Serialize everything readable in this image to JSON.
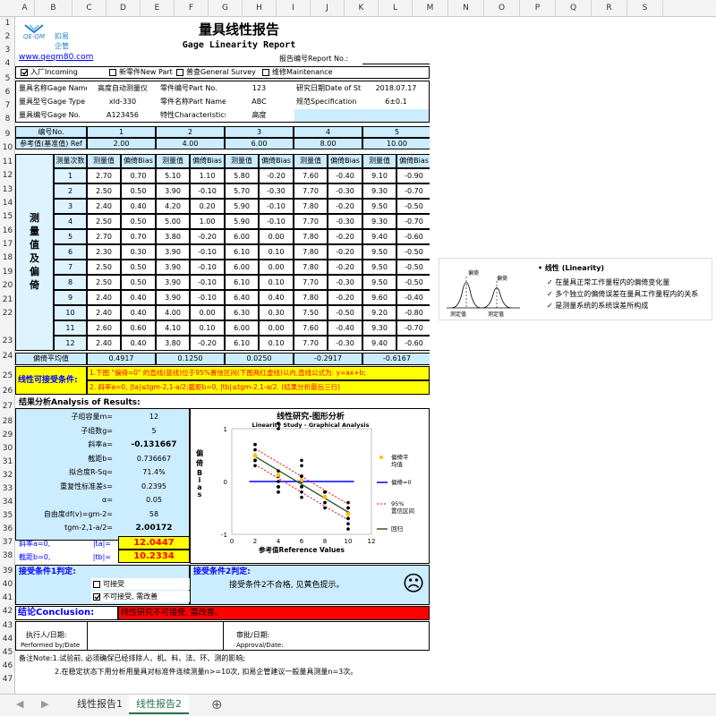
{
  "columns": [
    "A",
    "B",
    "C",
    "D",
    "E",
    "F",
    "G",
    "H",
    "I",
    "J",
    "K",
    "L",
    "M",
    "N",
    "O",
    "P",
    "Q",
    "R",
    "S"
  ],
  "rows": [
    "1",
    "2",
    "3",
    "4",
    "5",
    "6",
    "7",
    "8",
    "9",
    "10",
    "11",
    "12",
    "13",
    "14",
    "15",
    "16",
    "17",
    "18",
    "19",
    "20",
    "21",
    "22",
    "23",
    "24",
    "25",
    "26",
    "27",
    "28",
    "29",
    "30",
    "31",
    "32",
    "33",
    "34",
    "35",
    "36",
    "37",
    "38",
    "39",
    "40",
    "41",
    "42",
    "43",
    "44",
    "45",
    "46",
    "47"
  ],
  "logo": {
    "cn1": "扣易",
    "cn2": "企管",
    "en": "QE-QM",
    "url": "www.qeqm80.com"
  },
  "title": {
    "cn": "量具线性报告",
    "en": "Gage Linearity Report",
    "report_no_label": "报告编号Report No.:"
  },
  "checks": [
    {
      "label": "入厂Incoming",
      "checked": true
    },
    {
      "label": "新零件New Part",
      "checked": false
    },
    {
      "label": "普查General Survey",
      "checked": false
    },
    {
      "label": "维修Maintenance",
      "checked": false
    }
  ],
  "info": {
    "gage_name_l": "量具名称Gage Name",
    "gage_name_v": "高度自动测量仪",
    "part_no_l": "零件编号Part No.",
    "part_no_v": "123",
    "date_l": "研究日期Date of St",
    "date_v": "2018.07.17",
    "gage_type_l": "量具型号Gage Type",
    "gage_type_v": "xld-330",
    "part_name_l": "零件名称Part Name",
    "part_name_v": "ABC",
    "spec_l": "规范Specification",
    "spec_v": "6±0.1",
    "gage_no_l": "量具编号Gage No.",
    "gage_no_v": "A123456",
    "char_l": "特性Characteristics",
    "char_v": "高度"
  },
  "part_row": {
    "label": "编号No.",
    "nums": [
      "1",
      "2",
      "3",
      "4",
      "5"
    ]
  },
  "ref_row": {
    "label": "参考值(基准值) Ref",
    "values": [
      "2.00",
      "4.00",
      "6.00",
      "8.00",
      "10.00"
    ]
  },
  "meas_header": {
    "count": "测量次数",
    "meas": "测量值",
    "bias": "偏倚Bias"
  },
  "side_label": "测量值及偏倚",
  "meas_rows": [
    {
      "n": "1",
      "v": [
        "2.70",
        "0.70",
        "5.10",
        "1.10",
        "5.80",
        "-0.20",
        "7.60",
        "-0.40",
        "9.10",
        "-0.90"
      ]
    },
    {
      "n": "2",
      "v": [
        "2.50",
        "0.50",
        "3.90",
        "-0.10",
        "5.70",
        "-0.30",
        "7.70",
        "-0.30",
        "9.30",
        "-0.70"
      ]
    },
    {
      "n": "3",
      "v": [
        "2.40",
        "0.40",
        "4.20",
        "0.20",
        "5.90",
        "-0.10",
        "7.80",
        "-0.20",
        "9.50",
        "-0.50"
      ]
    },
    {
      "n": "4",
      "v": [
        "2.50",
        "0.50",
        "5.00",
        "1.00",
        "5.90",
        "-0.10",
        "7.70",
        "-0.30",
        "9.30",
        "-0.70"
      ]
    },
    {
      "n": "5",
      "v": [
        "2.70",
        "0.70",
        "3.80",
        "-0.20",
        "6.00",
        "0.00",
        "7.80",
        "-0.20",
        "9.40",
        "-0.60"
      ]
    },
    {
      "n": "6",
      "v": [
        "2.30",
        "0.30",
        "3.90",
        "-0.10",
        "6.10",
        "0.10",
        "7.80",
        "-0.20",
        "9.50",
        "-0.50"
      ]
    },
    {
      "n": "7",
      "v": [
        "2.50",
        "0.50",
        "3.90",
        "-0.10",
        "6.00",
        "0.00",
        "7.80",
        "-0.20",
        "9.50",
        "-0.50"
      ]
    },
    {
      "n": "8",
      "v": [
        "2.50",
        "0.50",
        "3.90",
        "-0.10",
        "6.10",
        "0.10",
        "7.70",
        "-0.30",
        "9.50",
        "-0.50"
      ]
    },
    {
      "n": "9",
      "v": [
        "2.40",
        "0.40",
        "3.90",
        "-0.10",
        "6.40",
        "0.40",
        "7.80",
        "-0.20",
        "9.60",
        "-0.40"
      ]
    },
    {
      "n": "10",
      "v": [
        "2.40",
        "0.40",
        "4.00",
        "0.00",
        "6.30",
        "0.30",
        "7.50",
        "-0.50",
        "9.20",
        "-0.80"
      ]
    },
    {
      "n": "11",
      "v": [
        "2.60",
        "0.60",
        "4.10",
        "0.10",
        "6.00",
        "0.00",
        "7.60",
        "-0.40",
        "9.30",
        "-0.70"
      ]
    },
    {
      "n": "12",
      "v": [
        "2.40",
        "0.40",
        "3.80",
        "-0.20",
        "6.10",
        "0.10",
        "7.70",
        "-0.30",
        "9.40",
        "-0.60"
      ]
    }
  ],
  "avg_row": {
    "label": "偏倚平均值",
    "values": [
      "0.4917",
      "0.1250",
      "0.0250",
      "-0.2917",
      "-0.6167"
    ]
  },
  "linearity": {
    "label": "线性可接受条件:",
    "line1": "1.下图 \"偏倚=0\" 的直线(蓝线)位于95%置信区间(下图两红虚线)以内,直线公式为: y=ax+b;",
    "line2": "2. 斜率a=0, |ta|≤tgm-2,1-a/2;截距b=0, |tb|≤tgm-2,1-a/2. (结果分析最后三行)"
  },
  "results": {
    "title": "结果分析Analysis of Results:",
    "rows": [
      {
        "l": "子组容量m=",
        "v": "12"
      },
      {
        "l": "子组数g=",
        "v": "5"
      },
      {
        "l": "斜率a=",
        "v": "-0.131667"
      },
      {
        "l": "截距b=",
        "v": "0.736667"
      },
      {
        "l": "拟合度R-Sq=",
        "v": "71.4%"
      },
      {
        "l": "重复性标准差s=",
        "v": "0.2395"
      },
      {
        "l": "α=",
        "v": "0.05"
      },
      {
        "l": "自由度df(v)=gm-2=",
        "v": "58"
      },
      {
        "l": "tgm-2,1-a/2=",
        "v": "2.00172"
      }
    ],
    "ta_label1": "斜率a=0,",
    "ta_label2": "|ta|=",
    "ta_value": "12.0447",
    "tb_label1": "截距b=0,",
    "tb_label2": "|tb|=",
    "tb_value": "10.2334"
  },
  "chart_data": {
    "type": "scatter",
    "title": "线性研究-图形分析",
    "subtitle": "Linearity Study - Graphical Analysis",
    "ylabel": "偏倚Bias",
    "xlabel": "参考值Reference Values",
    "xlim": [
      0,
      12
    ],
    "ylim": [
      -1,
      1
    ],
    "x_ticks": [
      "0",
      "2",
      "4",
      "6",
      "8",
      "10",
      "12"
    ],
    "y_ticks": [
      "1",
      "0",
      "-1"
    ],
    "points_x": [
      2,
      4,
      6,
      8,
      10
    ],
    "bias_points": [
      [
        0.7,
        0.5,
        0.4,
        0.5,
        0.7,
        0.3,
        0.5,
        0.5,
        0.4,
        0.4,
        0.6,
        0.4
      ],
      [
        1.1,
        -0.1,
        0.2,
        1.0,
        -0.2,
        -0.1,
        -0.1,
        -0.1,
        -0.1,
        0.0,
        0.1,
        -0.2
      ],
      [
        -0.2,
        -0.3,
        -0.1,
        -0.1,
        0.0,
        0.1,
        0.0,
        0.1,
        0.4,
        0.3,
        0.0,
        0.1
      ],
      [
        -0.4,
        -0.3,
        -0.2,
        -0.3,
        -0.2,
        -0.2,
        -0.2,
        -0.3,
        -0.2,
        -0.5,
        -0.4,
        -0.3
      ],
      [
        -0.9,
        -0.7,
        -0.5,
        -0.7,
        -0.6,
        -0.5,
        -0.5,
        -0.5,
        -0.4,
        -0.8,
        -0.7,
        -0.6
      ]
    ],
    "avg_bias": [
      0.4917,
      0.125,
      0.025,
      -0.2917,
      -0.6167
    ],
    "regression": {
      "slope": -0.131667,
      "intercept": 0.736667
    },
    "legend": [
      {
        "name": "偏倚平均值",
        "color": "#ffc000"
      },
      {
        "name": "偏倚=0",
        "color": "#0000ff"
      },
      {
        "name": "95%置信区间",
        "color": "#ff0000"
      },
      {
        "name": "回归",
        "color": "#385723"
      }
    ]
  },
  "accept1": {
    "label": "接受条件1判定:",
    "opt1": "可接受",
    "opt2": "不可接受, 需改善",
    "opt1_checked": false,
    "opt2_checked": true
  },
  "accept2": {
    "label": "接受条件2判定:",
    "text": "接受条件2不合格, 见黄色提示。",
    "face": "☹"
  },
  "conclusion": {
    "label": "结论Conclusion:",
    "text": "线性研究不可接受, 需改善。"
  },
  "sign": {
    "exec_cn": "执行人/日期:",
    "exec_en": "Performed by/Date",
    "approve_cn": "审批/日期:",
    "approve_en": "Approval/Date:"
  },
  "notes": {
    "n1": "备注Note:1.试验前, 必须确保已经排除人、机、料、法、环、测的影响;",
    "n2": "2.在稳定状态下用分析用量具对标准件连续测量n>=10次, 扣易企管建议一般量具测量n=3次。"
  },
  "side_image": {
    "bullet": "线性 (Linearity)",
    "items": [
      "在量具正常工作量程内的偏倚变化量",
      "多个独立的偏倚误差在量具工作量程内的关系",
      "是测量系统的系统误差所构成"
    ],
    "label1": "偏倚",
    "label2": "偏倚",
    "small1": "测定值",
    "small2": "测定值"
  },
  "tabs": [
    "线性报告1",
    "线性报告2"
  ],
  "colors": {
    "blue": "#ccecff",
    "yellow": "#ffff00",
    "red": "#ff0000",
    "title_blue": "#0000ff",
    "excel_green": "#217346"
  }
}
